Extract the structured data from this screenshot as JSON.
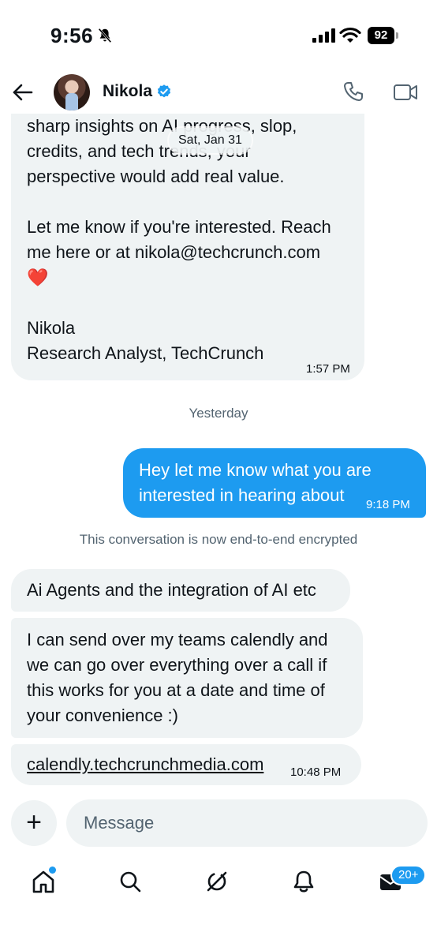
{
  "status_bar": {
    "time": "9:56",
    "battery": "92",
    "icons": [
      "bell-off-icon",
      "signal-icon",
      "wifi-icon",
      "battery-icon"
    ]
  },
  "header": {
    "name": "Nikola",
    "icons": [
      "back-arrow-icon",
      "verified-badge-icon",
      "phone-icon",
      "video-icon"
    ]
  },
  "conversation": {
    "first_message": {
      "lines": [
        "sharp insights on AI progress, slop,",
        "credits, and tech trends, your",
        "perspective would add real value.",
        "",
        "Let me know if you're interested. Reach",
        "me here or at nikola@techcrunch.com",
        "❤️",
        "",
        "Nikola",
        "Research Analyst, TechCrunch"
      ],
      "time": "1:57 PM"
    },
    "date_pill": "Sat, Jan 31",
    "day_separator": "Yesterday",
    "outgoing": {
      "lines": [
        "Hey let me know what you are",
        "interested in hearing about"
      ],
      "time": "9:18 PM"
    },
    "encryption_notice": "This conversation is now end-to-end encrypted",
    "incoming": [
      {
        "text": "Ai Agents and the integration of AI etc"
      },
      {
        "lines": [
          "I can send over my teams calendly and",
          "we can go over everything over a call if",
          "this works for you at a date and time of",
          "your convenience :)"
        ]
      },
      {
        "link": "calendly.techcrunchmedia.com",
        "time": "10:48 PM"
      }
    ]
  },
  "composer": {
    "placeholder": "Message",
    "plus": "+"
  },
  "nav": {
    "items": [
      "home-icon",
      "search-icon",
      "grok-icon",
      "notifications-icon",
      "messages-icon"
    ],
    "messages_badge": "20+"
  },
  "colors": {
    "accent": "#1d9bf0",
    "bubble_in": "#eff3f4",
    "secondary_text": "#536471"
  }
}
